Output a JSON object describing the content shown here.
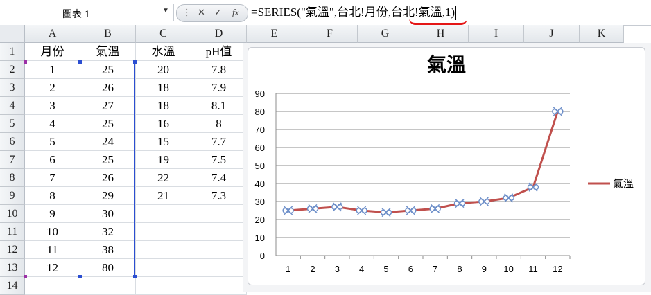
{
  "formula_bar": {
    "name_box": "圖表 1",
    "cancel_icon": "✕",
    "enter_icon": "✓",
    "fx_label": "fx",
    "formula": "=SERIES(\"氣溫\",台北!月份,台北!氣溫,1)"
  },
  "sheet": {
    "columns": [
      "A",
      "B",
      "C",
      "D",
      "E",
      "F",
      "G",
      "H",
      "I",
      "J",
      "K"
    ],
    "rows": [
      "1",
      "2",
      "3",
      "4",
      "5",
      "6",
      "7",
      "8",
      "9",
      "10",
      "11",
      "12",
      "13",
      "14"
    ],
    "headers": [
      "月份",
      "氣溫",
      "水溫",
      "pH值"
    ],
    "data": [
      [
        "1",
        "25",
        "20",
        "7.8"
      ],
      [
        "2",
        "26",
        "18",
        "7.9"
      ],
      [
        "3",
        "27",
        "18",
        "8.1"
      ],
      [
        "4",
        "25",
        "16",
        "8"
      ],
      [
        "5",
        "24",
        "15",
        "7.7"
      ],
      [
        "6",
        "25",
        "19",
        "7.5"
      ],
      [
        "7",
        "26",
        "22",
        "7.4"
      ],
      [
        "8",
        "29",
        "21",
        "7.3"
      ],
      [
        "9",
        "30",
        "",
        ""
      ],
      [
        "10",
        "32",
        "",
        ""
      ],
      [
        "11",
        "38",
        "",
        ""
      ],
      [
        "12",
        "80",
        "",
        ""
      ]
    ]
  },
  "chart_data": {
    "type": "line",
    "title": "氣溫",
    "x": [
      1,
      2,
      3,
      4,
      5,
      6,
      7,
      8,
      9,
      10,
      11,
      12
    ],
    "series": [
      {
        "name": "氣溫",
        "values": [
          25,
          26,
          27,
          25,
          24,
          25,
          26,
          29,
          30,
          32,
          38,
          80
        ],
        "color": "#c0504d"
      }
    ],
    "xlabel": "",
    "ylabel": "",
    "ylim": [
      0,
      90
    ],
    "yticks": [
      0,
      10,
      20,
      30,
      40,
      50,
      60,
      70,
      80,
      90
    ],
    "grid": true,
    "legend": "right"
  }
}
